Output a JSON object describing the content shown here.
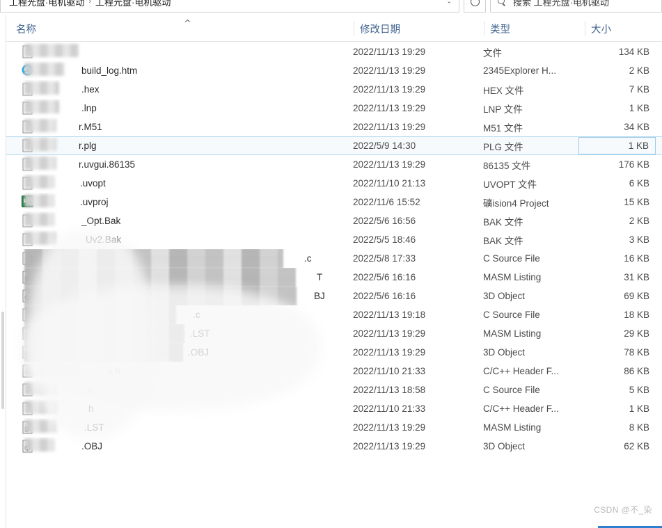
{
  "window": {
    "address_crumb_1": "工程光盘·电机驱动",
    "address_crumb_2": "工程光盘·电机驱动",
    "address_separator": "›",
    "dropdown_caret": "⌄",
    "refresh_tooltip": "刷新",
    "search_prefix": "搜索",
    "search_value": "搜索 工程光盘·电机驱动"
  },
  "columns": {
    "name": "名称",
    "date_modified": "修改日期",
    "type": "类型",
    "size": "大小",
    "sort_caret": "^"
  },
  "files": [
    {
      "name": "",
      "prefix_redact": 62,
      "icon": "blank-file-icon",
      "date": "2022/11/13 19:29",
      "type": "文件",
      "size": "134 KB",
      "redact_w": 78,
      "redact_style": "soft",
      "selected": false
    },
    {
      "name": "build_log.htm",
      "prefix_redact": 62,
      "icon": "ie-browser-icon",
      "date": "2022/11/13 19:29",
      "type": "2345Explorer H...",
      "size": "2 KB",
      "redact_w": 58,
      "redact_style": "soft",
      "selected": false
    },
    {
      "name": ".hex",
      "prefix_redact": 62,
      "icon": "blank-file-icon",
      "date": "2022/11/13 19:29",
      "type": "HEX 文件",
      "size": "7 KB",
      "redact_w": 50,
      "redact_style": "soft",
      "selected": false
    },
    {
      "name": ".lnp",
      "prefix_redact": 62,
      "icon": "blank-file-icon",
      "date": "2022/11/13 19:29",
      "type": "LNP 文件",
      "size": "1 KB",
      "redact_w": 50,
      "redact_style": "soft",
      "selected": false
    },
    {
      "name": "r.M51",
      "prefix_redact": 58,
      "icon": "blank-file-icon",
      "date": "2022/11/13 19:29",
      "type": "M51 文件",
      "size": "34 KB",
      "redact_w": 46,
      "redact_style": "soft",
      "selected": false
    },
    {
      "name": "r.plg",
      "prefix_redact": 58,
      "icon": "blank-file-icon",
      "date": "2022/5/9 14:30",
      "type": "PLG 文件",
      "size": "1 KB",
      "redact_w": 46,
      "redact_style": "soft",
      "selected": true
    },
    {
      "name": "r.uvgui.86135",
      "prefix_redact": 58,
      "icon": "blank-file-icon",
      "date": "2022/11/13 19:29",
      "type": "86135 文件",
      "size": "176 KB",
      "redact_w": 46,
      "redact_style": "soft",
      "selected": false
    },
    {
      "name": ".uvopt",
      "prefix_redact": 60,
      "icon": "blank-file-icon",
      "date": "2022/11/10 21:13",
      "type": "UVOPT 文件",
      "size": "6 KB",
      "redact_w": 44,
      "redact_style": "soft",
      "selected": false
    },
    {
      "name": ".uvproj",
      "prefix_redact": 60,
      "icon": "keil-uvision-icon",
      "date": "2022/11/6 15:52",
      "type": "礦ision4 Project",
      "size": "15 KB",
      "redact_w": 44,
      "redact_style": "soft",
      "selected": false
    },
    {
      "name": "_Opt.Bak",
      "prefix_redact": 62,
      "icon": "blank-file-icon",
      "date": "2022/5/6 16:56",
      "type": "BAK 文件",
      "size": "2 KB",
      "redact_w": 44,
      "redact_style": "soft",
      "selected": false
    },
    {
      "name": "Uv2.Bak",
      "prefix_redact": 68,
      "icon": "blank-file-icon",
      "date": "2022/5/5 18:46",
      "type": "BAK 文件",
      "size": "3 KB",
      "redact_w": 46,
      "redact_style": "soft",
      "selected": false
    },
    {
      "name": ".c",
      "prefix_redact": 382,
      "icon": "blank-file-icon",
      "date": "2022/5/8 17:33",
      "type": "C Source File",
      "size": "16 KB",
      "redact_w": 372,
      "redact_style": "mosaic",
      "selected": false
    },
    {
      "name": "T",
      "prefix_redact": 400,
      "icon": "listing-file-icon",
      "date": "2022/5/6 16:16",
      "type": "MASM Listing",
      "size": "31 KB",
      "redact_w": 390,
      "redact_style": "mosaic",
      "selected": false
    },
    {
      "name": "BJ",
      "prefix_redact": 396,
      "icon": "obj-3d-icon",
      "date": "2022/5/6 16:16",
      "type": "3D Object",
      "size": "69 KB",
      "redact_w": 392,
      "redact_style": "mosaic",
      "selected": false
    },
    {
      "name": ".c",
      "prefix_redact": 222,
      "icon": "blank-file-icon",
      "date": "2022/11/13 19:18",
      "type": "C Source File",
      "size": "18 KB",
      "redact_w": 218,
      "redact_style": "mosaic",
      "selected": false
    },
    {
      "name": ".LST",
      "prefix_redact": 218,
      "icon": "listing-file-icon",
      "date": "2022/11/13 19:29",
      "type": "MASM Listing",
      "size": "29 KB",
      "redact_w": 230,
      "redact_style": "mosaic",
      "selected": false
    },
    {
      "name": ".OBJ",
      "prefix_redact": 215,
      "icon": "obj-3d-icon",
      "date": "2022/11/13 19:29",
      "type": "3D Object",
      "size": "78 KB",
      "redact_w": 228,
      "redact_style": "mosaic",
      "selected": false
    },
    {
      "name": "x.h",
      "prefix_redact": 100,
      "icon": "blank-file-icon",
      "date": "2022/11/10 21:33",
      "type": "C/C++ Header F...",
      "size": "86 KB",
      "redact_w": 80,
      "redact_style": "soft",
      "selected": false
    },
    {
      "name": "c",
      "prefix_redact": 72,
      "icon": "blank-file-icon",
      "date": "2022/11/13 18:58",
      "type": "C Source File",
      "size": "5 KB",
      "redact_w": 48,
      "redact_style": "soft",
      "selected": false
    },
    {
      "name": "h",
      "prefix_redact": 72,
      "icon": "blank-file-icon",
      "date": "2022/11/10 21:33",
      "type": "C/C++ Header F...",
      "size": "1 KB",
      "redact_w": 48,
      "redact_style": "soft",
      "selected": false
    },
    {
      "name": ".LST",
      "prefix_redact": 66,
      "icon": "listing-file-icon",
      "date": "2022/11/13 19:29",
      "type": "MASM Listing",
      "size": "8 KB",
      "redact_w": 46,
      "redact_style": "soft",
      "selected": false
    },
    {
      "name": ".OBJ",
      "prefix_redact": 62,
      "icon": "obj-3d-icon",
      "date": "2022/11/13 19:29",
      "type": "3D Object",
      "size": "62 KB",
      "redact_w": 44,
      "redact_style": "soft",
      "selected": false
    }
  ],
  "watermark": "CSDN @不_染",
  "colors": {
    "header_text": "#41648f",
    "row_text": "#2b2b2b",
    "selection_border": "#9ecbea",
    "selection_fill": "#f6fafd",
    "accent": "#2f7fd0"
  }
}
